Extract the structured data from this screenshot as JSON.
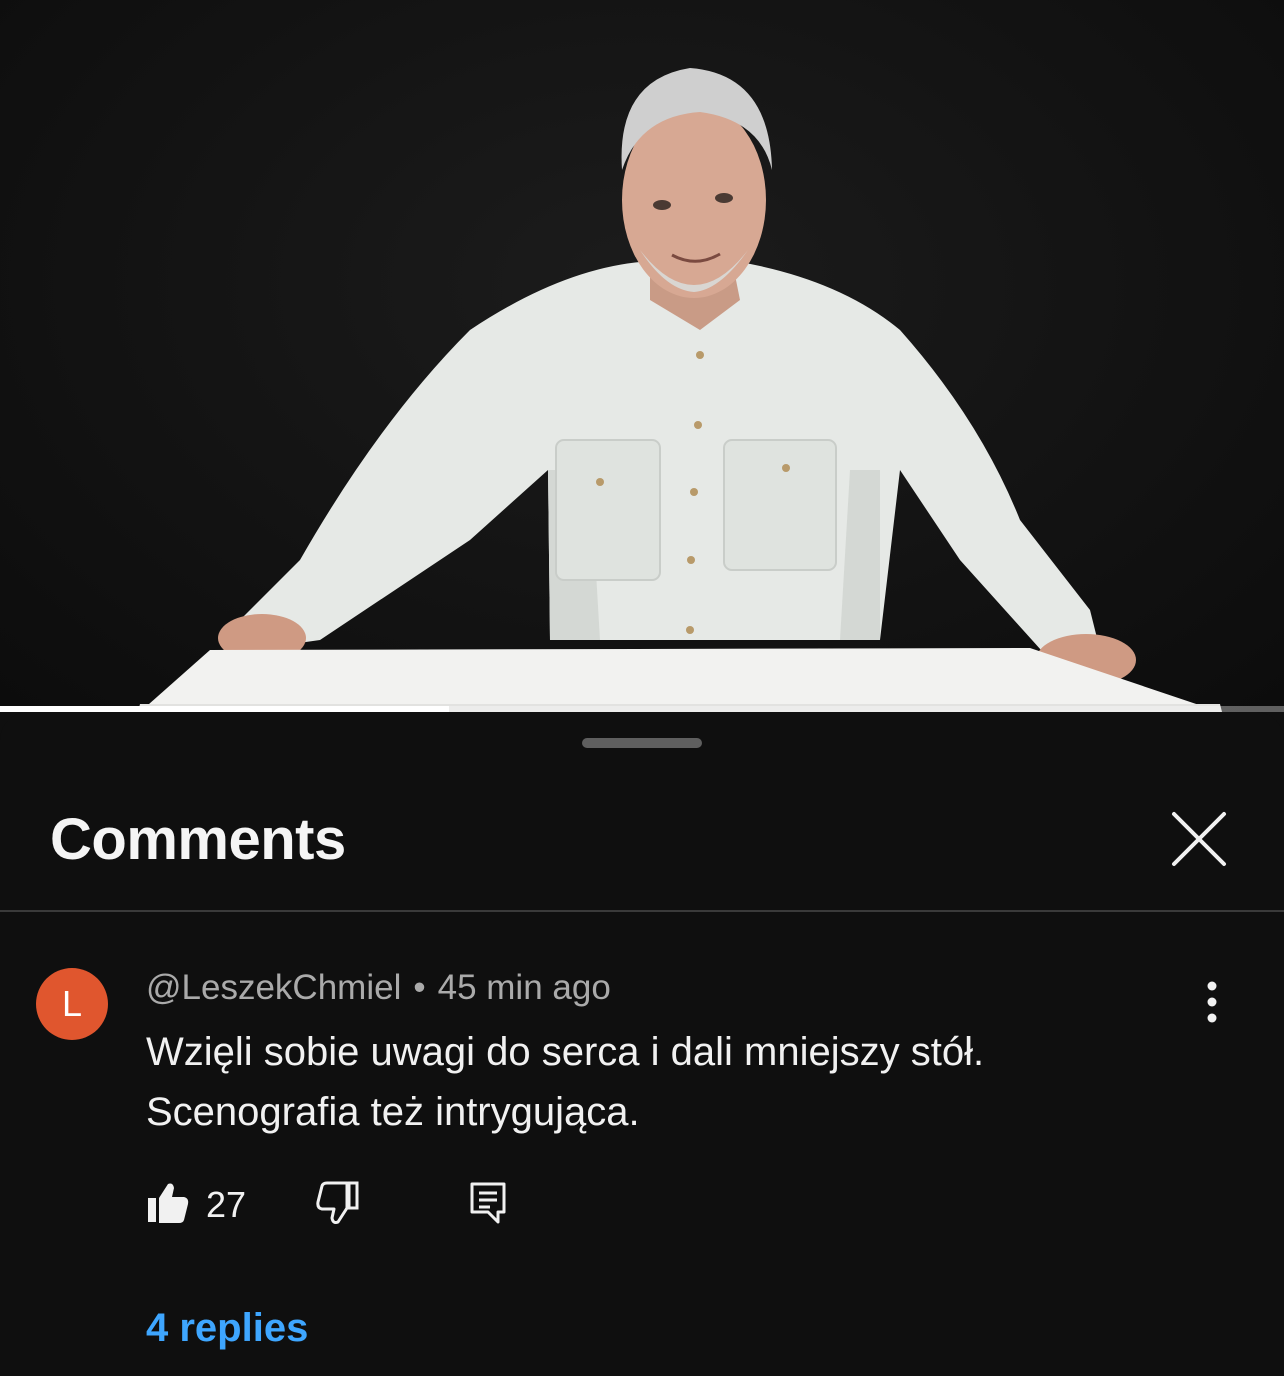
{
  "video": {
    "progress_fraction": 0.35
  },
  "comments_panel": {
    "title": "Comments",
    "close_icon": "close-icon",
    "comments": [
      {
        "avatar_letter": "L",
        "avatar_color": "#e0562e",
        "author": "@LeszekChmiel",
        "separator": "•",
        "time": "45 min ago",
        "text_line_1": "Wzięli sobie uwagi do serca i dali mniejszy stół.",
        "text_line_2": "Scenografia też intrygująca.",
        "like_count": "27",
        "replies_label": "4 replies"
      }
    ]
  },
  "colors": {
    "background": "#0f0f0f",
    "link": "#3ea6ff",
    "secondary_text": "#aaaaaa"
  }
}
